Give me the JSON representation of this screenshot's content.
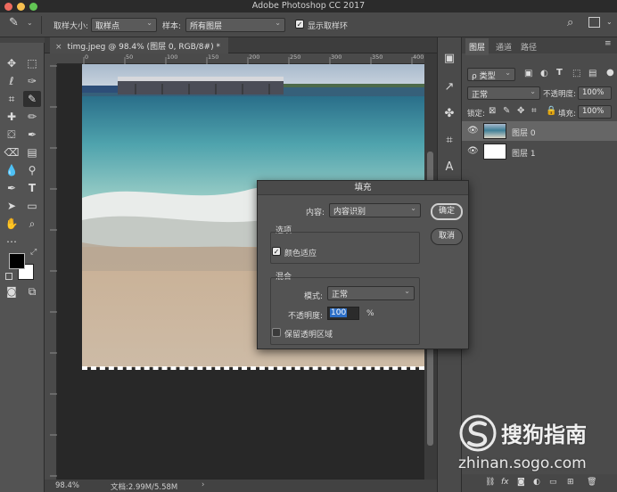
{
  "app": {
    "title": "Adobe Photoshop CC 2017"
  },
  "options_bar": {
    "sample_size_label": "取样大小:",
    "sample_size_value": "取样点",
    "sample_label": "样本:",
    "sample_value": "所有图层",
    "show_ring_label": "显示取样环",
    "show_ring_checked": true
  },
  "document": {
    "tab_title": "timg.jpeg @ 98.4% (图层 0, RGB/8#) *",
    "ruler_ticks": [
      "0",
      "50",
      "100",
      "150",
      "200",
      "250",
      "300",
      "350",
      "400",
      "450",
      "500"
    ],
    "zoom": "98.4%",
    "doc_size": "文档:2.99M/5.58M"
  },
  "layers_panel": {
    "tabs": [
      "图层",
      "通道",
      "路径"
    ],
    "filter_label": "ρ 类型",
    "blend_mode": "正常",
    "opacity_label": "不透明度:",
    "opacity_value": "100%",
    "lock_label": "锁定:",
    "fill_label": "填充:",
    "fill_value": "100%",
    "layers": [
      {
        "name": "图层 0",
        "selected": true
      },
      {
        "name": "图层 1",
        "selected": false
      }
    ]
  },
  "fill_dialog": {
    "title": "填充",
    "content_label": "内容:",
    "content_value": "内容识别",
    "ok_label": "确定",
    "cancel_label": "取消",
    "options_group": "选项",
    "color_adapt_label": "颜色适应",
    "color_adapt_checked": true,
    "blend_group": "混合",
    "mode_label": "模式:",
    "mode_value": "正常",
    "opacity_label": "不透明度:",
    "opacity_value": "100",
    "percent": "%",
    "preserve_label": "保留透明区域",
    "preserve_checked": false
  },
  "watermark": {
    "brand": "搜狗指南",
    "url": "zhinan.sogo.com"
  },
  "colors": {
    "accent": "#2d6fc7",
    "panel": "#535353",
    "dark": "#282828"
  }
}
